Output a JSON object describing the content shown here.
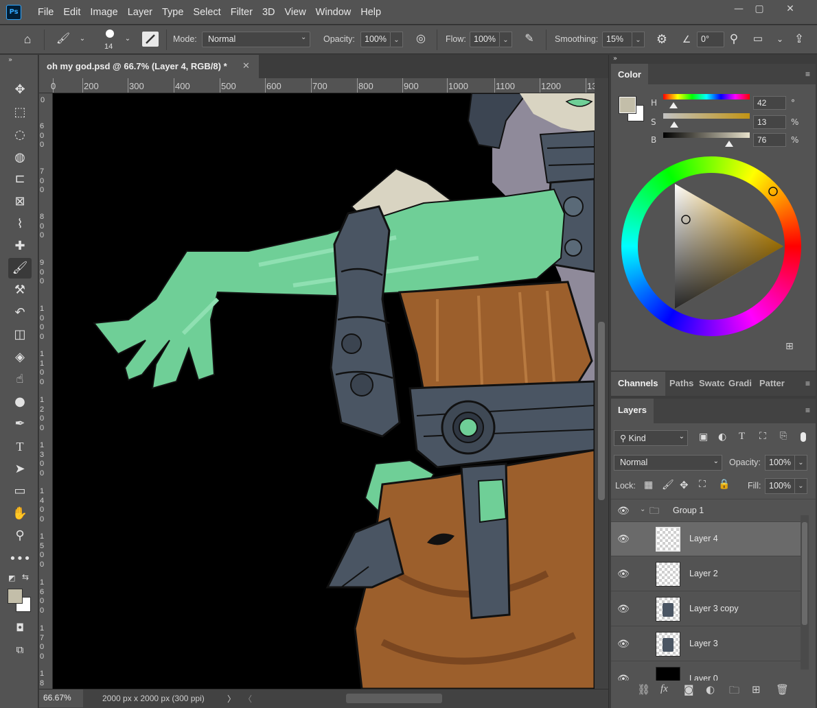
{
  "app": {
    "logo_text": "Ps"
  },
  "menu": [
    "File",
    "Edit",
    "Image",
    "Layer",
    "Type",
    "Select",
    "Filter",
    "3D",
    "View",
    "Window",
    "Help"
  ],
  "window_controls": {
    "minimize": "—",
    "restore": "▢",
    "close": "✕"
  },
  "options_bar": {
    "brush_size": "14",
    "mode_label": "Mode:",
    "mode_value": "Normal",
    "opacity_label": "Opacity:",
    "opacity_value": "100%",
    "flow_label": "Flow:",
    "flow_value": "100%",
    "smoothing_label": "Smoothing:",
    "smoothing_value": "15%",
    "angle_value": "0°"
  },
  "document": {
    "tab_title": "oh my god.psd @ 66.7% (Layer 4, RGB/8) *",
    "close_glyph": "✕",
    "h_ruler": [
      "0",
      "200",
      "300",
      "400",
      "500",
      "600",
      "700",
      "800",
      "900",
      "1000",
      "1100",
      "1200",
      "13"
    ],
    "v_ruler": [
      "0",
      "6 0 0",
      "7 0 0",
      "8 0 0",
      "9 0 0",
      "1 0 0 0",
      "1 1 0 0",
      "1 2 0 0",
      "1 3 0 0",
      "1 4 0 0",
      "1 5 0 0",
      "1 6 0 0",
      "1 7 0 0",
      "1 8"
    ],
    "zoom": "66.67%",
    "info": "2000 px x 2000 px (300 ppi)",
    "info_arrow": "〉",
    "scroll_left": "〈"
  },
  "color_panel": {
    "tab": "Color",
    "h_label": "H",
    "h_value": "42",
    "h_unit": "°",
    "s_label": "S",
    "s_value": "13",
    "s_unit": "%",
    "b_label": "B",
    "b_value": "76",
    "b_unit": "%",
    "foreground": "#c3bea9",
    "background": "#ffffff",
    "hue_fraction": 0.117,
    "sat_fraction": 0.13,
    "bri_fraction": 0.76
  },
  "mid_panel": {
    "tabs": [
      "Channels",
      "Paths",
      "Swatc",
      "Gradi",
      "Patter"
    ]
  },
  "layers_panel": {
    "tab": "Layers",
    "kind_label": "Kind",
    "blend_mode": "Normal",
    "opacity_label": "Opacity:",
    "opacity_value": "100%",
    "lock_label": "Lock:",
    "fill_label": "Fill:",
    "fill_value": "100%",
    "group_name": "Group 1",
    "layers": [
      "Layer 4",
      "Layer 2",
      "Layer 3 copy",
      "Layer 3",
      "Layer 0"
    ],
    "selected_layer": "Layer 4"
  },
  "colors": {
    "ui_bg": "#535353",
    "canvas_bg": "#000000",
    "skin_green": "#6fcf97",
    "armor": "#4a5563",
    "cloth_orange": "#9c5f2c"
  }
}
